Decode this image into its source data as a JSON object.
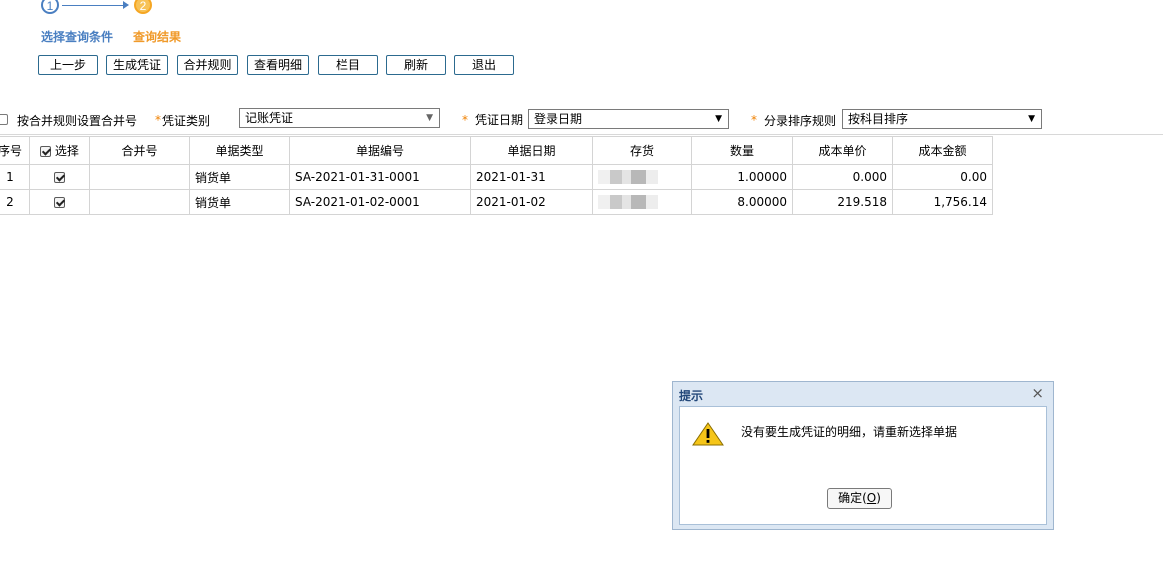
{
  "steps": [
    {
      "number": "1",
      "label": "选择查询条件"
    },
    {
      "number": "2",
      "label": "查询结果"
    }
  ],
  "toolbar": {
    "prev_label": "上一步",
    "generate_label": "生成凭证",
    "merge_rule_label": "合并规则",
    "view_detail_label": "查看明细",
    "columns_label": "栏目",
    "refresh_label": "刷新",
    "exit_label": "退出"
  },
  "filters": {
    "merge_by_rule_label": "按合并规则设置合并号",
    "voucher_type_label": "凭证类别",
    "voucher_type_value": "记账凭证",
    "voucher_date_label": "凭证日期",
    "voucher_date_value": "登录日期",
    "entry_sort_label": "分录排序规则",
    "entry_sort_value": "按科目排序",
    "required_mark": "*"
  },
  "table": {
    "headers": {
      "seq": "序号",
      "select": "选择",
      "merge_no": "合并号",
      "doc_type": "单据类型",
      "doc_no": "单据编号",
      "doc_date": "单据日期",
      "inventory": "存货",
      "quantity": "数量",
      "unit_cost": "成本单价",
      "cost_amount": "成本金额"
    },
    "rows": [
      {
        "seq": "1",
        "selected": true,
        "merge_no": "",
        "doc_type": "销货单",
        "doc_no": "SA-2021-01-31-0001",
        "doc_date": "2021-01-31",
        "quantity": "1.00000",
        "unit_cost": "0.000",
        "cost_amount": "0.00"
      },
      {
        "seq": "2",
        "selected": true,
        "merge_no": "",
        "doc_type": "销货单",
        "doc_no": "SA-2021-01-02-0001",
        "doc_date": "2021-01-02",
        "quantity": "8.00000",
        "unit_cost": "219.518",
        "cost_amount": "1,756.14"
      }
    ]
  },
  "dialog": {
    "title": "提示",
    "close_glyph": "×",
    "message": "没有要生成凭证的明细，请重新选择单据",
    "ok_label": "确定(",
    "ok_mnemonic": "O",
    "ok_label_end": ")",
    "icon": "warning-icon"
  },
  "colors": {
    "step_active": "#4a7fc1",
    "step_current": "#f09a2a",
    "button_border": "#2c6a8f",
    "required": "#f08000",
    "dialog_title": "#23487a"
  }
}
